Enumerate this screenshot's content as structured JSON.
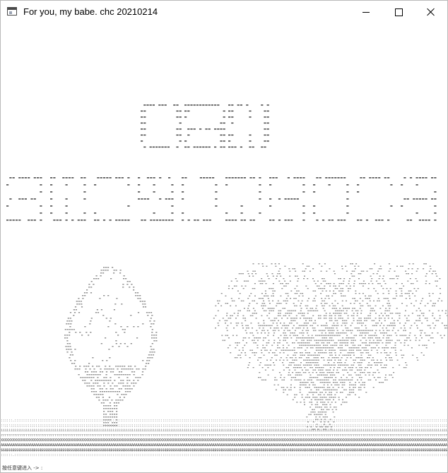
{
  "window": {
    "title": "For you, my babe. chc 20210214",
    "icons": {
      "app": "console-window-icon",
      "minimize": "minimize-icon",
      "maximize": "maximize-icon",
      "close": "close-icon"
    }
  },
  "art": {
    "glyph_color": "#8a8a8a",
    "dark_glyph_color": "#4d4d4d"
  },
  "ticker": {
    "lines": [
      "::::::.:::::::::::::::::::::::::::::::::::::::::::::::::::::::::::::::::::::::::::::::::::::::::::::::::::::::::::::::::::::::::::::::::::::::::::::::::::::::::::::::::::::::::::::::::::::::::::::::::::::::::::::::::::::::::::::::::::::::::::::::::::::::::::::::::::",
      "::;;:;;;;;;;;;;;;;;;;;;;;;;;;;;;;;;;;;;;;;;;;;;;;;;;;;;;;;;;;;;;;;;;;;;;;;;;;;;;;;;;;;;;;;;;;;;;;;;;;;;;;;;;;;;;;;;;;;;;;;;;;;;;;;;;;;;;;;;;;;;;;;;;;;;;;;;;;;;;;;;;;;;;;;;;;;;;;;;;;;;;;;;;;;;;;;;;;;;;;;;;;;;;;;;;;;;;;;;;;;;;;;;;;;;;;;;;;;;",
      "iiiiiiiiiiiiiiiiiiiiiiiiiiiiiiiiiiiiiiiiiiiiiiiiiiiiiiiiiiiiiiiiiiiiiiiiiiiiiiiiiiiiiiiiiiiiiiiiiiiiiiiiiiiiiiiiiiiiiiiiiiiiiiiiiiiiiiiiiiiiiiiiiiiiiiiiiiiiiiiiiiiiiiiiiiiiiiiiiiiiiiiiiiiiiiiiiiiiiiiiiiiiiiiiiiiiiiiiiiiiiiiiiiiiiiiiiiiiiiiiiiiiiiiiii",
      "rrrrrrrrrrrrrrrrrrrrrrrrrrrrrrrrrrrrrrrrrrrrrrrrrrrrrrrrrrrrrrrrrrrrrrrrrrrrrrrrrrrrrrrrrrrrrrrrrrrrrrrrrrrrrrrrrrrrrrrrrrrrrrrrrrrrrrrrrrrrrrrrrrrrrrrrrrrrrrrrrrrrrrrrrrrrrrrrrrrrrrrrrrrrrrrrrrrrrrrrrrrrrrrrrrrrrrrrrrrrrrrrrrrrrrrrrrrrrrrrrrrrrrr",
      "XXXXXXXXXXXXXXXXXXXXXXXXXXXXXXXXXXXXXXXXXXXXXXXXXXXXXXXXXXXXXXXXXXXXXXXXXXXXXXXXXXXXXXXXXXXXXXXXXXXXXXXXXXXXXXXXXXXXXXXXXXXXXXXXXXXXXXXXXXXXXXXXXXXXXXXXXXXXXXXXXXXXXXXXXXXXXXXXXXXXXXXXXXXXXXXXXXXXXXXXXXXXXXXXXXXXXXXXXXXXXXXXXXXXXXXXXXXXXXXXXXXXXXX",
      "AAAAAAAAAAAAAAAAAAAAAAAAAAAAAAAAAAAAAAAAAAAAAAAAAAAAAAAAAAAAAAAAAAAAAAAAAAAAAAAAAAAAAAAAAAAAAAAAAAAAAAAAAAAAAAAAAAAAAAAAAAAAAAAAAAAAAAAAAAAAAAAAAAAAAAAAAAAAAAAAAAAAAAAAAAAAAAAAAAAAAAAAAAAAAAAAAAAAAAAAAAAAAAAAAAAAAAAAAAAAAAAAAAAAAAAAAAAAAAAAAAAAAAAAAAAAA",
      "$$$$$$$$$$$$$$$$$$$$$$$$$$$$$$$$$$$$$$$$$$$$$$$$$$$$$$$$$$$$$$$$$$$$$$$$$$$$$$$$$$$$$$$$$$$$$$$$$$$$$$$$$$$$$$$$$$$$$$$$$$$$$$$$$$$$$$$$$$$$$$$$$$$$$$$$$$$$$$$$$$$$$$$$$$$$$$$$$$$$$$$$$$$$$$$$$$$$$$$$$$$$$$$$$$$$$$$$$$$$$$$$$$$$$$$$$$$$$$$$$$$$$$$$$$$$$$$$",
      "::::::.:::::::::::::::::::::::::::::::::::::::::::::::::::::::::::::::::::::::::::::::::::::::::::::::::::::::::::::::::::::::::::::::::::::::::::::::::::::::::::::::::::::::::::::::::::::::::::::::::::::::::::::::::::::::::::::::::::::::::::::::::::::::::::::::::::"
    ]
  },
  "status": {
    "text": "按任意键进入 -> :"
  }
}
